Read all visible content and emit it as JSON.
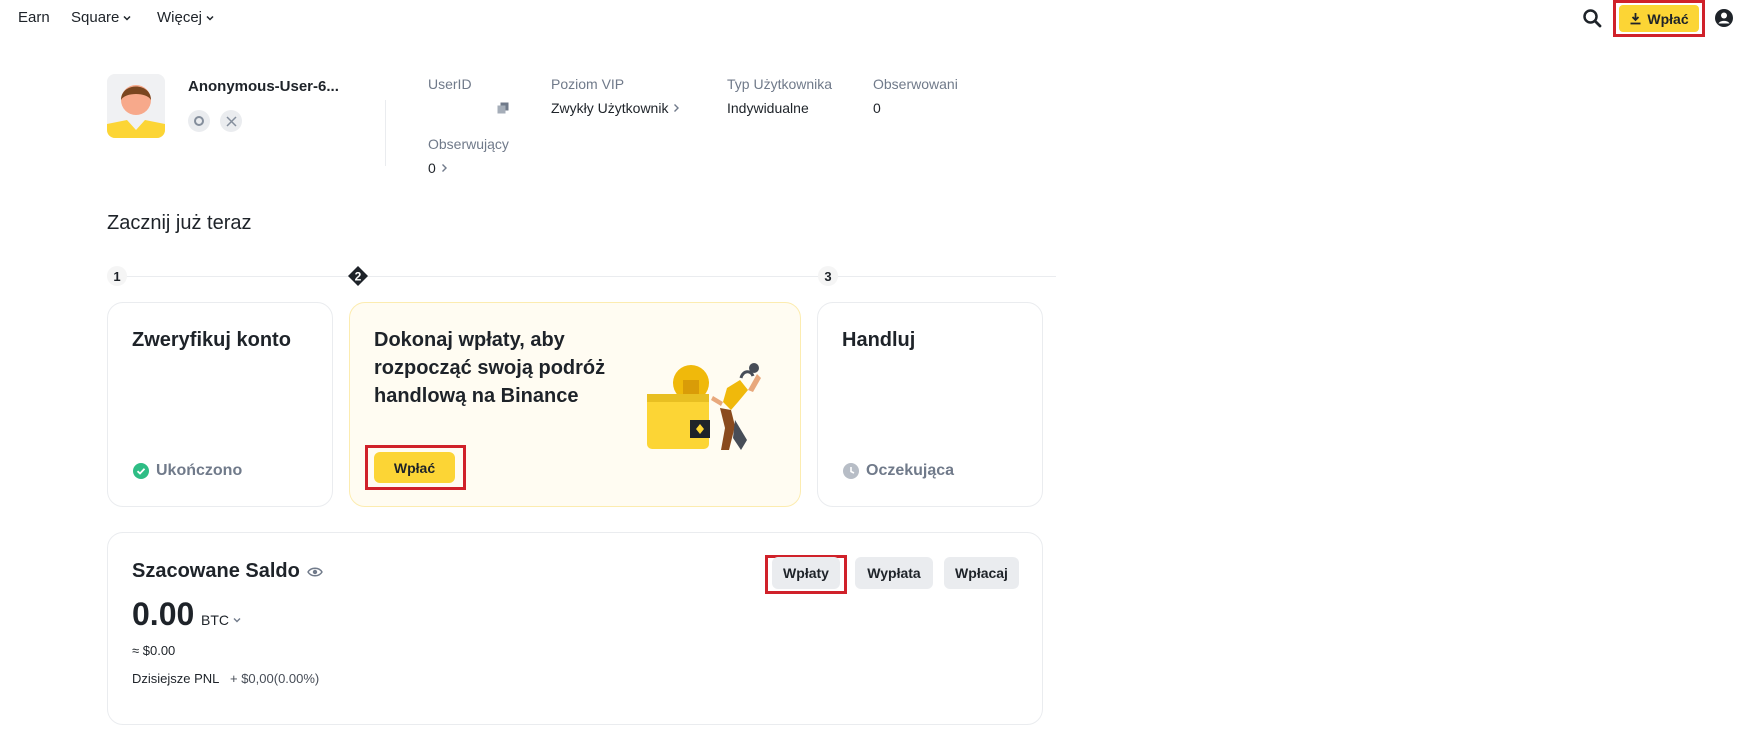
{
  "nav": {
    "earn": "Earn",
    "square": "Square",
    "more": "Więcej",
    "deposit": "Wpłać"
  },
  "profile": {
    "username": "Anonymous-User-6...",
    "userid_label": "UserID",
    "vip_label": "Poziom VIP",
    "vip_value": "Zwykły Użytkownik",
    "type_label": "Typ Użytkownika",
    "type_value": "Indywidualne",
    "following_label": "Obserwowani",
    "following_value": "0",
    "followers_label": "Obserwujący",
    "followers_value": "0"
  },
  "get_started": {
    "title": "Zacznij już teraz",
    "steps": [
      {
        "num": "1",
        "title": "Zweryfikuj konto",
        "status": "Ukończono"
      },
      {
        "num": "2",
        "title_lines": [
          "Dokonaj wpłaty, aby",
          "rozpocząć swoją podróż",
          "handlową na Binance"
        ],
        "button": "Wpłać"
      },
      {
        "num": "3",
        "title": "Handluj",
        "status": "Oczekująca"
      }
    ]
  },
  "balance": {
    "title": "Szacowane Saldo",
    "value": "0.00",
    "unit": "BTC",
    "usd": "≈ $0.00",
    "pnl_label": "Dzisiejsze PNL",
    "pnl_value": "+ $0,00(0.00%)",
    "buttons": {
      "deposit": "Wpłaty",
      "withdraw": "Wypłata",
      "transfer": "Wpłacaj"
    }
  },
  "colors": {
    "accent": "#fcd535",
    "highlight": "#d0212a",
    "success": "#2ebd85"
  }
}
